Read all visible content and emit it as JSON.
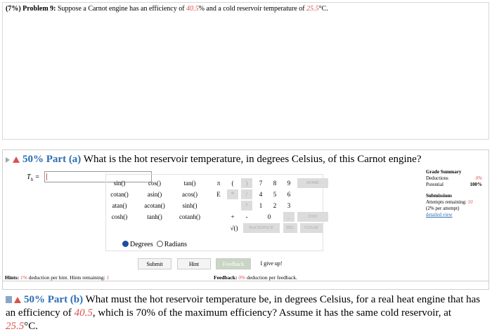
{
  "problem": {
    "percent": "(7%)",
    "label": "Problem 9:",
    "text_1": "Suppose a Carnot engine has an efficiency of",
    "efficiency": "40.5",
    "text_2": "% and a cold reservoir temperature of",
    "cold_temp": "25.5",
    "text_3": "°C."
  },
  "part_a": {
    "label": "50% Part (a)",
    "question": "What is the hot reservoir temperature, in degrees Celsius, of this Carnot engine?",
    "var_label": "T",
    "var_sub": "h",
    "equals": "=",
    "input_value": ""
  },
  "calculator": {
    "functions": [
      [
        "sin()",
        "cos()",
        "tan()"
      ],
      [
        "cotan()",
        "asin()",
        "acos()"
      ],
      [
        "atan()",
        "acotan()",
        "sinh()"
      ],
      [
        "cosh()",
        "tanh()",
        "cotanh()"
      ]
    ],
    "pi": "π",
    "lparen": "(",
    "rparen": ")",
    "e": "E",
    "plus": "+",
    "minus": "-",
    "sqrt": "√()",
    "digits": [
      [
        "7",
        "8",
        "9"
      ],
      [
        "4",
        "5",
        "6"
      ],
      [
        "1",
        "2",
        "3"
      ]
    ],
    "zero": "0",
    "home": "HOME",
    "end": "END",
    "backspace": "BACKSPACE",
    "del": "DEL",
    "clear": "CLEAR",
    "star": "*",
    "slash": "/",
    "hat": "^",
    "dot": ".",
    "degrees": "Degrees",
    "radians": "Radians"
  },
  "buttons": {
    "submit": "Submit",
    "hint": "Hint",
    "feedback": "Feedback",
    "give_up": "I give up!"
  },
  "grade_summary": {
    "title": "Grade Summary",
    "deductions_label": "Deductions",
    "deductions_value": "0%",
    "potential_label": "Potential",
    "potential_value": "100%",
    "submissions_title": "Submissions",
    "attempts_label": "Attempts remaining:",
    "attempts_value": "10",
    "per_attempt": "(2% per attempt)",
    "detailed_view": "detailed view"
  },
  "hints": {
    "label": "Hints:",
    "pct": "1%",
    "text": "deduction per hint. Hints remaining:",
    "remaining": "1"
  },
  "feedback": {
    "label": "Feedback:",
    "pct": "0%",
    "text": "deduction per feedback."
  },
  "part_b": {
    "label": "50% Part (b)",
    "text_1": "What must the hot reservoir temperature be, in degrees Celsius, for a real heat engine that has an efficiency of",
    "efficiency": "40.5",
    "text_2": ", which is 70% of the maximum efficiency? Assume it has the same cold reservoir, at",
    "cold_temp": "25.5",
    "text_3": "°C."
  }
}
